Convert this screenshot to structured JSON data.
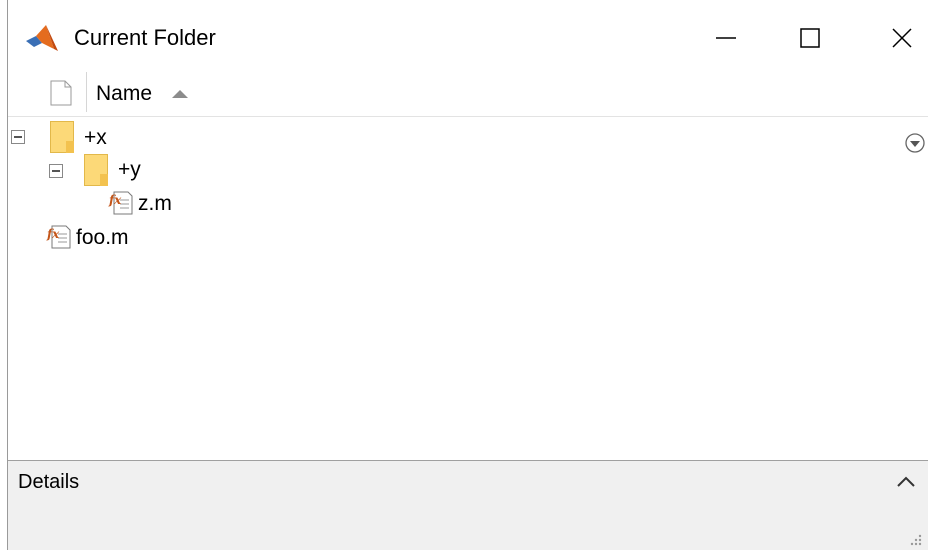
{
  "window": {
    "title": "Current Folder",
    "controls": {
      "minimize_icon": "minimize-icon",
      "maximize_icon": "maximize-icon",
      "close_icon": "close-icon"
    }
  },
  "columns": {
    "type_icon": "file-icon",
    "name_label": "Name",
    "sort": "ascending"
  },
  "tree": {
    "items": [
      {
        "label": "+x",
        "type": "folder",
        "expanded": true
      },
      {
        "label": "+y",
        "type": "folder",
        "expanded": true
      },
      {
        "label": "z.m",
        "type": "m-file"
      },
      {
        "label": "foo.m",
        "type": "m-file"
      }
    ]
  },
  "details": {
    "label": "Details",
    "collapse_icon": "chevron-up-icon"
  },
  "colors": {
    "folder": "#fcd978",
    "matlab_logo": "#e46c1f",
    "panel_bg": "#f0f0f0"
  }
}
